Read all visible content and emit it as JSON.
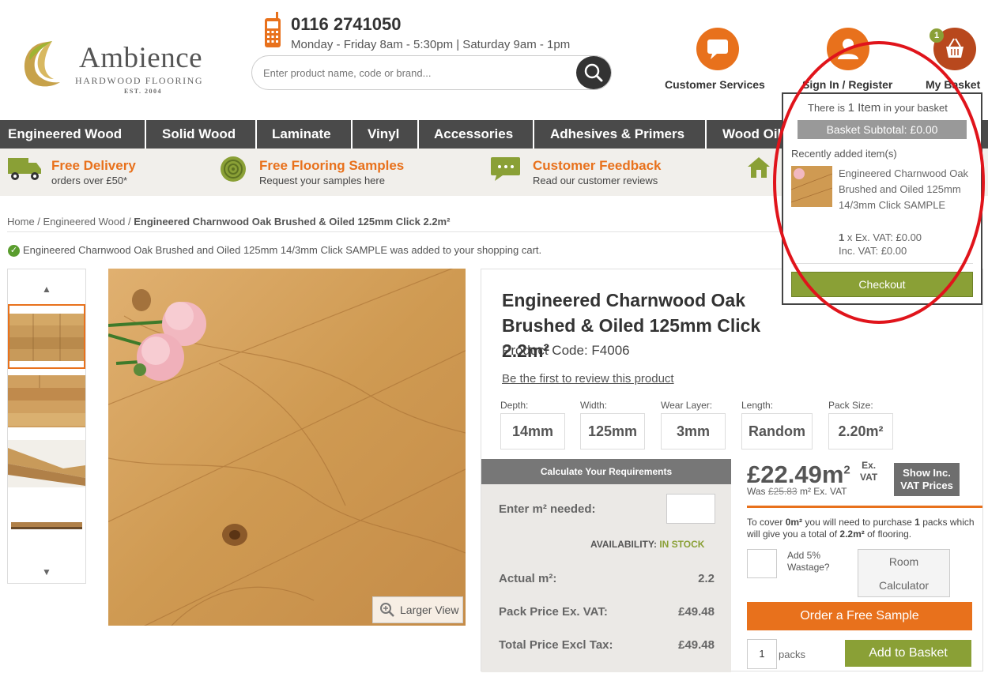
{
  "header": {
    "logo_name": "Ambience",
    "logo_sub": "HARDWOOD FLOORING",
    "logo_est": "EST. 2004",
    "phone": "0116 2741050",
    "hours": "Monday - Friday 8am - 5:30pm  |  Saturday 9am - 1pm",
    "search_placeholder": "Enter product name, code or brand...",
    "customer_services": "Customer Services",
    "sign_in": "Sign In / Register",
    "basket": "My Basket",
    "basket_count": "1",
    "accent": "#e8711c"
  },
  "nav": [
    "Engineered Wood",
    "Solid Wood",
    "Laminate",
    "Vinyl",
    "Accessories",
    "Adhesives & Primers",
    "Wood Oil"
  ],
  "features": [
    {
      "title": "Free Delivery",
      "sub": "orders over £50*",
      "icon": "truck-icon"
    },
    {
      "title": "Free Flooring Samples",
      "sub": "Request your samples here",
      "icon": "wood-roll-icon"
    },
    {
      "title": "Customer Feedback",
      "sub": "Read our customer reviews",
      "icon": "chat-icon"
    }
  ],
  "breadcrumb": {
    "home": "Home",
    "sep": " / ",
    "category": "Engineered Wood",
    "current": "Engineered Charnwood Oak Brushed & Oiled 125mm Click 2.2m²"
  },
  "message": "Engineered Charnwood Oak Brushed and Oiled 125mm 14/3mm Click SAMPLE was added to your shopping cart.",
  "image": {
    "larger_view": "Larger View"
  },
  "product": {
    "title": "Engineered Charnwood Oak Brushed & Oiled 125mm Click 2.2m²",
    "code": "Product Code: F4006",
    "review": "Be the first to review this product",
    "specs": [
      {
        "label": "Depth:",
        "value": "14mm"
      },
      {
        "label": "Width:",
        "value": "125mm"
      },
      {
        "label": "Wear Layer:",
        "value": "3mm"
      },
      {
        "label": "Length:",
        "value": "Random"
      },
      {
        "label": "Pack Size:",
        "value": "2.20m²"
      }
    ],
    "calc": {
      "header": "Calculate Your Requirements",
      "enter_label": "Enter m² needed:",
      "availability_label": "AVAILABILITY:",
      "availability": "IN STOCK",
      "actual_label": "Actual m²:",
      "actual": "2.2",
      "pack_label": "Pack Price Ex. VAT:",
      "pack": "£49.48",
      "total_label": "Total Price Excl Tax:",
      "total": "£49.48"
    },
    "price": "£22.49m",
    "price_sup": "2",
    "ex_vat_1": "Ex.",
    "ex_vat_2": "VAT",
    "show_vat_1": "Show Inc.",
    "show_vat_2": "VAT Prices",
    "was_prefix": "Was",
    "was_price": "£25.83",
    "was_suffix": "m² Ex. VAT",
    "cover_text_1": "To cover",
    "cover_m2": "0m²",
    "cover_text_2": "you will need to purchase",
    "cover_packs": "1",
    "cover_text_3": "packs which will give you a total of",
    "cover_total": "2.2m²",
    "cover_text_4": "of flooring.",
    "wastage_1": "Add 5%",
    "wastage_2": "Wastage?",
    "room_1": "Room",
    "room_2": "Calculator",
    "sample_button": "Order a Free Sample",
    "qty": "1",
    "packs": "packs",
    "add_button": "Add to Basket"
  },
  "basket_dropdown": {
    "count_pre": "There is",
    "count_item": "1 Item",
    "count_post": "in your basket",
    "subtotal": "Basket Subtotal: £0.00",
    "recent": "Recently added item(s)",
    "item_name": "Engineered Charnwood Oak Brushed and Oiled 125mm 14/3mm Click SAMPLE",
    "item_qty": "1",
    "item_ex": "x Ex. VAT: £0.00",
    "item_inc": "Inc. VAT: £0.00",
    "checkout": "Checkout"
  }
}
